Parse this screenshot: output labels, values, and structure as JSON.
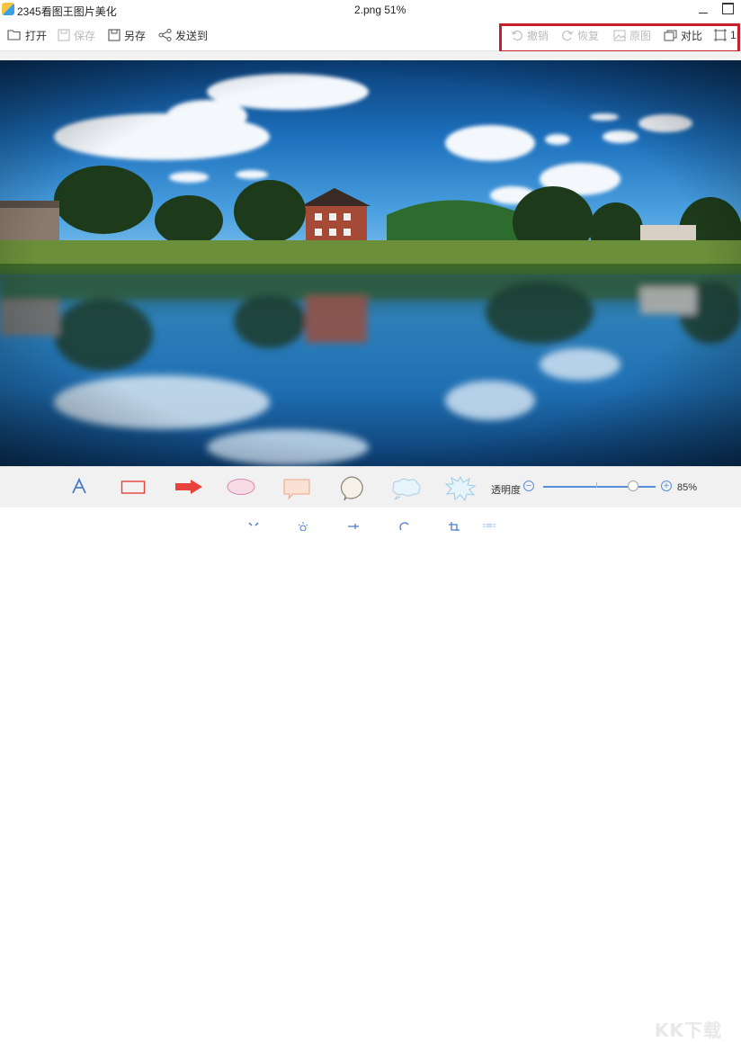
{
  "window": {
    "app_title": "2345看图王图片美化",
    "file_title": "2.png  51%"
  },
  "toolbar": {
    "left": [
      {
        "label": "打开",
        "icon": "folder-open-icon",
        "enabled": true
      },
      {
        "label": "保存",
        "icon": "save-icon",
        "enabled": false
      },
      {
        "label": "另存",
        "icon": "save-as-icon",
        "enabled": true
      },
      {
        "label": "发送到",
        "icon": "share-icon",
        "enabled": true
      }
    ],
    "right": [
      {
        "label": "撤销",
        "icon": "undo-icon",
        "enabled": false
      },
      {
        "label": "恢复",
        "icon": "redo-icon",
        "enabled": false
      },
      {
        "label": "原图",
        "icon": "original-image-icon",
        "enabled": false
      },
      {
        "label": "对比",
        "icon": "compare-icon",
        "enabled": true
      },
      {
        "label": "1:",
        "icon": "actual-size-icon",
        "enabled": true
      }
    ],
    "highlight_color": "#c8202a"
  },
  "annotation_tools": [
    {
      "name": "text-tool",
      "icon": "letter-a-icon",
      "glyph": "A"
    },
    {
      "name": "rectangle-tool",
      "icon": "rectangle-icon"
    },
    {
      "name": "arrow-tool",
      "icon": "arrow-icon"
    },
    {
      "name": "ellipse-tool",
      "icon": "ellipse-icon"
    },
    {
      "name": "callout-tool",
      "icon": "callout-icon"
    },
    {
      "name": "round-callout-tool",
      "icon": "round-callout-icon"
    },
    {
      "name": "cloud-callout-tool",
      "icon": "cloud-callout-icon"
    },
    {
      "name": "burst-callout-tool",
      "icon": "burst-callout-icon"
    }
  ],
  "opacity": {
    "label": "透明度",
    "value_text": "85%",
    "value": 0.85
  },
  "colors": {
    "accent": "#5a8fd8",
    "arrow_red": "#e8423a",
    "rect_red": "#e8423a"
  },
  "watermark": "KK下载"
}
